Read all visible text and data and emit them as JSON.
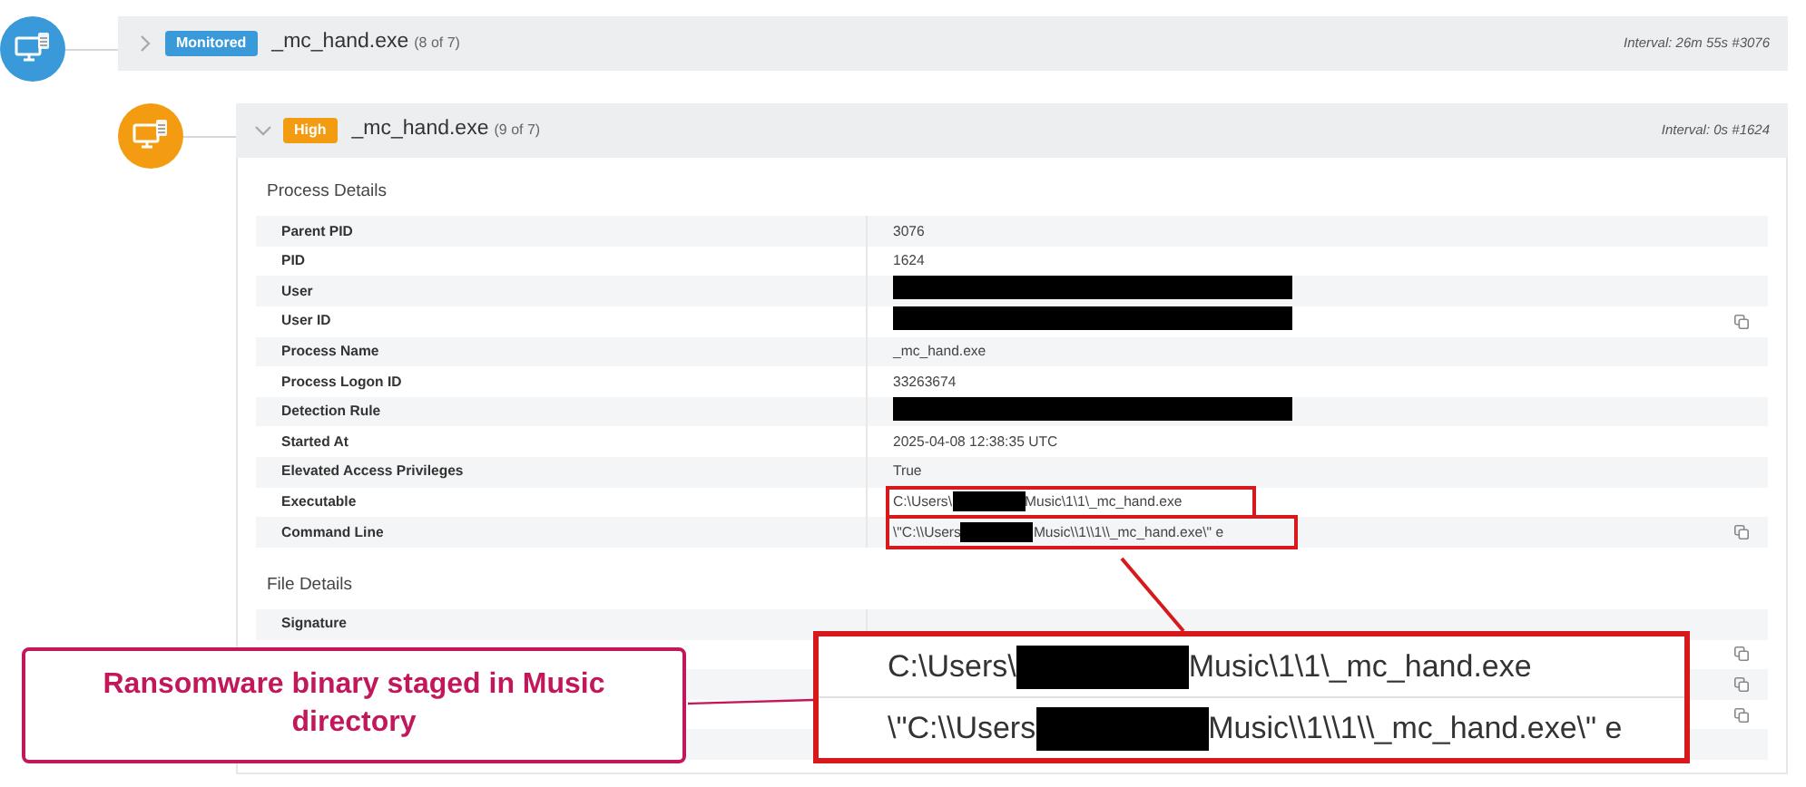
{
  "nodes": [
    {
      "status": "Monitored",
      "color": "#3a9ad9",
      "expanded": false,
      "process": "_mc_hand.exe",
      "count": "(8 of 7)",
      "interval": "Interval: 26m 55s #3076"
    },
    {
      "status": "High",
      "color": "#f39c12",
      "expanded": true,
      "process": "_mc_hand.exe",
      "count": "(9 of 7)",
      "interval": "Interval: 0s #1624",
      "sections": [
        {
          "title": "Process Details",
          "rows": [
            {
              "label": "Parent PID",
              "value": [
                {
                  "kind": "text",
                  "text": "3076"
                }
              ],
              "copy": false
            },
            {
              "label": "PID",
              "value": [
                {
                  "kind": "text",
                  "text": "1624"
                }
              ],
              "copy": false
            },
            {
              "label": "User",
              "value": [
                {
                  "kind": "redacted"
                }
              ],
              "copy": false
            },
            {
              "label": "User ID",
              "value": [
                {
                  "kind": "redacted"
                }
              ],
              "copy": true
            },
            {
              "label": "Process Name",
              "value": [
                {
                  "kind": "text",
                  "text": "_mc_hand.exe"
                }
              ],
              "copy": false
            },
            {
              "label": "Process Logon ID",
              "value": [
                {
                  "kind": "text",
                  "text": "33263674"
                }
              ],
              "copy": false
            },
            {
              "label": "Detection Rule",
              "value": [
                {
                  "kind": "redacted"
                }
              ],
              "copy": false
            },
            {
              "label": "Started At",
              "value": [
                {
                  "kind": "text",
                  "text": "2025-04-08 12:38:35 UTC"
                }
              ],
              "copy": false
            },
            {
              "label": "Elevated Access Privileges",
              "value": [
                {
                  "kind": "text",
                  "text": "True"
                }
              ],
              "copy": false
            },
            {
              "label": "Executable",
              "value": [
                {
                  "kind": "text",
                  "text": "C:\\Users\\"
                },
                {
                  "kind": "redacted"
                },
                {
                  "kind": "text",
                  "text": "Music\\1\\1\\_mc_hand.exe"
                }
              ],
              "copy": false,
              "highlighted": true
            },
            {
              "label": "Command Line",
              "value": [
                {
                  "kind": "text",
                  "text": "\\\"C:\\\\Users"
                },
                {
                  "kind": "redacted"
                },
                {
                  "kind": "text",
                  "text": "Music\\\\1\\\\1\\\\_mc_hand.exe\\\" e"
                }
              ],
              "copy": true,
              "highlighted": true
            }
          ]
        },
        {
          "title": "File Details",
          "rows": [
            {
              "label": "Signature",
              "value": [],
              "copy": false
            },
            {
              "label": "",
              "value": [],
              "copy": true
            },
            {
              "label": "",
              "value": [],
              "copy": true
            },
            {
              "label": "",
              "value": [],
              "copy": true
            },
            {
              "label": "",
              "value": [],
              "copy": false
            }
          ]
        }
      ]
    }
  ],
  "callout": {
    "text": "Ransomware binary staged in Music directory"
  },
  "zoom_inset": {
    "rows": [
      [
        {
          "kind": "text",
          "text": "C:\\Users\\"
        },
        {
          "kind": "redacted"
        },
        {
          "kind": "text",
          "text": "Music\\1\\1\\_mc_hand.exe"
        }
      ],
      [
        {
          "kind": "text",
          "text": "\\\"C:\\\\Users"
        },
        {
          "kind": "redacted"
        },
        {
          "kind": "text",
          "text": "Music\\\\1\\\\1\\\\_mc_hand.exe\\\" e"
        }
      ]
    ]
  }
}
